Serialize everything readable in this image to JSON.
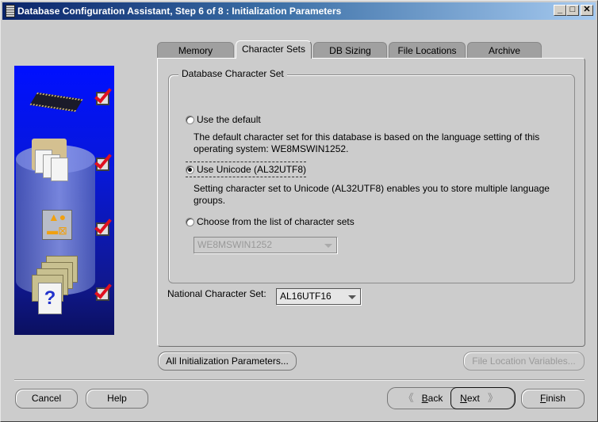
{
  "window": {
    "title": "Database Configuration Assistant, Step 6 of 8 : Initialization Parameters",
    "controls": {
      "minimize": "_",
      "maximize": "□",
      "close": "✕"
    }
  },
  "wizard_steps": [
    {
      "icon": "memory-chip-icon",
      "completed": true
    },
    {
      "icon": "documents-folder-icon",
      "completed": true
    },
    {
      "icon": "shapes-tile-icon",
      "completed": true
    },
    {
      "icon": "help-document-icon",
      "completed": true
    }
  ],
  "tabs": [
    {
      "label": "Memory",
      "active": false
    },
    {
      "label": "Character Sets",
      "active": true
    },
    {
      "label": "DB Sizing",
      "active": false
    },
    {
      "label": "File Locations",
      "active": false
    },
    {
      "label": "Archive",
      "active": false
    }
  ],
  "character_set_group": {
    "title": "Database Character Set",
    "options": [
      {
        "label": "Use the default",
        "selected": false,
        "description": "The default character set for this database is based on the language setting of this operating system: WE8MSWIN1252."
      },
      {
        "label": "Use Unicode (AL32UTF8)",
        "selected": true,
        "description": "Setting character set to Unicode (AL32UTF8) enables you to store multiple language groups."
      },
      {
        "label": "Choose from the list of character sets",
        "selected": false,
        "description": ""
      }
    ],
    "charset_list": {
      "value": "WE8MSWIN1252",
      "enabled": false
    }
  },
  "national_charset": {
    "label": "National Character Set:",
    "value": "AL16UTF16"
  },
  "panel_buttons": {
    "all_init_params": "All Initialization Parameters...",
    "file_location_vars": "File Location Variables..."
  },
  "footer": {
    "cancel": "Cancel",
    "help": "Help",
    "back": "Back",
    "back_mnemonic": "B",
    "back_rest": "ack",
    "next": "Next",
    "next_mnemonic": "N",
    "next_rest": "ext",
    "finish": "Finish",
    "finish_mnemonic": "F",
    "finish_rest": "inish"
  }
}
